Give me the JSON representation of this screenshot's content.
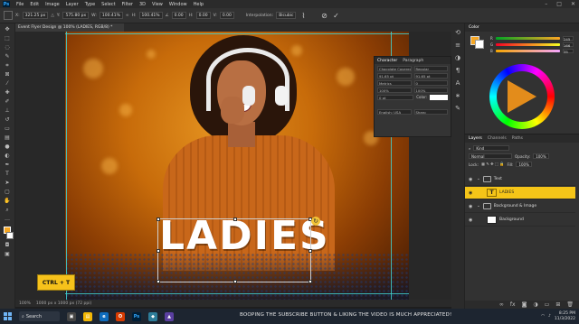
{
  "menubar": {
    "items": [
      "File",
      "Edit",
      "Image",
      "Layer",
      "Type",
      "Select",
      "Filter",
      "3D",
      "View",
      "Window",
      "Help"
    ]
  },
  "options": {
    "x_label": "X:",
    "x_value": "321.25 px",
    "y_label": "Y:",
    "y_value": "575.80 px",
    "w_label": "W:",
    "w_value": "100.41%",
    "h_label": "H:",
    "h_value": "100.41%",
    "angle_value": "0.00",
    "h_skew": "0.00",
    "v_skew": "0.00",
    "interp_label": "Interpolation:",
    "interp_value": "Bicubic"
  },
  "document": {
    "tab_title": "Event Flyer Design @ 100% (LADIES, RGB/8) *"
  },
  "canvas": {
    "headline": "LADIES"
  },
  "shortcut": {
    "text": "CTRL + T"
  },
  "status": {
    "zoom": "100%",
    "doc_info": "1000 px x 1000 px (72 ppi)"
  },
  "character": {
    "tabs": [
      "Character",
      "Paragraph"
    ],
    "font_family": "Chocolate Covered...",
    "font_style": "Regular",
    "size": "91.65 pt",
    "leading": "91.65 pt",
    "kerning": "Metrics",
    "tracking": "0",
    "v_scale": "100%",
    "h_scale": "100%",
    "baseline": "0 pt",
    "color_label": "Color:",
    "language": "English: USA",
    "aa": "Sharp"
  },
  "color_panel": {
    "title": "Color",
    "r_value": "245",
    "g_value": "166",
    "b_value": "35",
    "foreground": "#f5a623",
    "background": "#ffffff"
  },
  "layers_panel": {
    "tabs": [
      "Layers",
      "Channels",
      "Paths"
    ],
    "kind_label": "Kind",
    "blend_mode": "Normal",
    "opacity_label": "Opacity:",
    "opacity_value": "100%",
    "lock_label": "Lock:",
    "fill_label": "Fill:",
    "fill_value": "100%",
    "layers": [
      {
        "name": "Text",
        "type": "group"
      },
      {
        "name": "LADIES",
        "type": "text"
      },
      {
        "name": "Background & Image",
        "type": "group"
      },
      {
        "name": "Background",
        "type": "image"
      }
    ]
  },
  "taskbar": {
    "search_label": "Search",
    "ticker": "BOOPING THE SUBSCRIBE BUTTON & LIKING THE VIDEO IS MUCH APPRECIATED!",
    "time": "8:25 PM",
    "date": "11/3/2022"
  }
}
